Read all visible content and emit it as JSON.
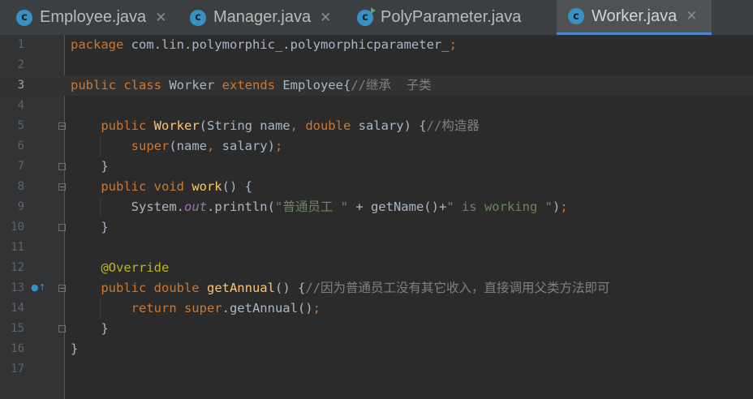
{
  "tabs": [
    {
      "label": "Employee.java",
      "icon": "class-icon",
      "active": false
    },
    {
      "label": "Manager.java",
      "icon": "class-icon",
      "active": false
    },
    {
      "label": "PolyParameter.java",
      "icon": "runnable-class-icon",
      "active": false
    },
    {
      "label": "Worker.java",
      "icon": "class-icon",
      "active": true
    }
  ],
  "editor": {
    "current_line": 3,
    "lines": [
      {
        "n": "1",
        "tokens": [
          {
            "t": "package ",
            "c": "kw"
          },
          {
            "t": "com.lin.polymorphic_.polymorphicparameter_",
            "c": ""
          },
          {
            "t": ";",
            "c": "kw"
          }
        ]
      },
      {
        "n": "2",
        "tokens": []
      },
      {
        "n": "3",
        "tokens": [
          {
            "t": "public class ",
            "c": "kw"
          },
          {
            "t": "Worker ",
            "c": ""
          },
          {
            "t": "extends ",
            "c": "kw"
          },
          {
            "t": "Employee{",
            "c": ""
          },
          {
            "t": "//继承  子类",
            "c": "cm"
          }
        ]
      },
      {
        "n": "4",
        "tokens": []
      },
      {
        "n": "5",
        "tokens": [
          {
            "t": "    public ",
            "c": "kw"
          },
          {
            "t": "Worker",
            "c": "fn"
          },
          {
            "t": "(String name",
            "c": ""
          },
          {
            "t": ", ",
            "c": "kw"
          },
          {
            "t": "double ",
            "c": "kw"
          },
          {
            "t": "salary) {",
            "c": ""
          },
          {
            "t": "//构造器",
            "c": "cm"
          }
        ]
      },
      {
        "n": "6",
        "tokens": [
          {
            "t": "        super",
            "c": "kw"
          },
          {
            "t": "(name",
            "c": ""
          },
          {
            "t": ", ",
            "c": "kw"
          },
          {
            "t": "salary)",
            "c": ""
          },
          {
            "t": ";",
            "c": "kw"
          }
        ]
      },
      {
        "n": "7",
        "tokens": [
          {
            "t": "    }",
            "c": ""
          }
        ]
      },
      {
        "n": "8",
        "tokens": [
          {
            "t": "    public void ",
            "c": "kw"
          },
          {
            "t": "work",
            "c": "fn"
          },
          {
            "t": "() {",
            "c": ""
          }
        ]
      },
      {
        "n": "9",
        "tokens": [
          {
            "t": "        System.",
            "c": ""
          },
          {
            "t": "out",
            "c": "it"
          },
          {
            "t": ".println(",
            "c": ""
          },
          {
            "t": "\"普通员工 \"",
            "c": "st"
          },
          {
            "t": " + getName()+",
            "c": ""
          },
          {
            "t": "\" is working \"",
            "c": "st"
          },
          {
            "t": ")",
            "c": ""
          },
          {
            "t": ";",
            "c": "kw"
          }
        ]
      },
      {
        "n": "10",
        "tokens": [
          {
            "t": "    }",
            "c": ""
          }
        ]
      },
      {
        "n": "11",
        "tokens": []
      },
      {
        "n": "12",
        "tokens": [
          {
            "t": "    @Override",
            "c": "an"
          }
        ]
      },
      {
        "n": "13",
        "tokens": [
          {
            "t": "    public double ",
            "c": "kw"
          },
          {
            "t": "getAnnual",
            "c": "fn"
          },
          {
            "t": "() {",
            "c": ""
          },
          {
            "t": "//因为普通员工没有其它收入，直接调用父类方法即可",
            "c": "cm"
          }
        ]
      },
      {
        "n": "14",
        "tokens": [
          {
            "t": "        return super",
            "c": "kw"
          },
          {
            "t": ".getAnnual()",
            "c": ""
          },
          {
            "t": ";",
            "c": "kw"
          }
        ]
      },
      {
        "n": "15",
        "tokens": [
          {
            "t": "    }",
            "c": ""
          }
        ]
      },
      {
        "n": "16",
        "tokens": [
          {
            "t": "}",
            "c": ""
          }
        ]
      },
      {
        "n": "17",
        "tokens": []
      }
    ],
    "fold_markers": [
      {
        "line": "5",
        "type": "open"
      },
      {
        "line": "7",
        "type": "close"
      },
      {
        "line": "8",
        "type": "open"
      },
      {
        "line": "10",
        "type": "close"
      },
      {
        "line": "13",
        "type": "open"
      },
      {
        "line": "15",
        "type": "close"
      }
    ],
    "override_marker_line": "13"
  }
}
